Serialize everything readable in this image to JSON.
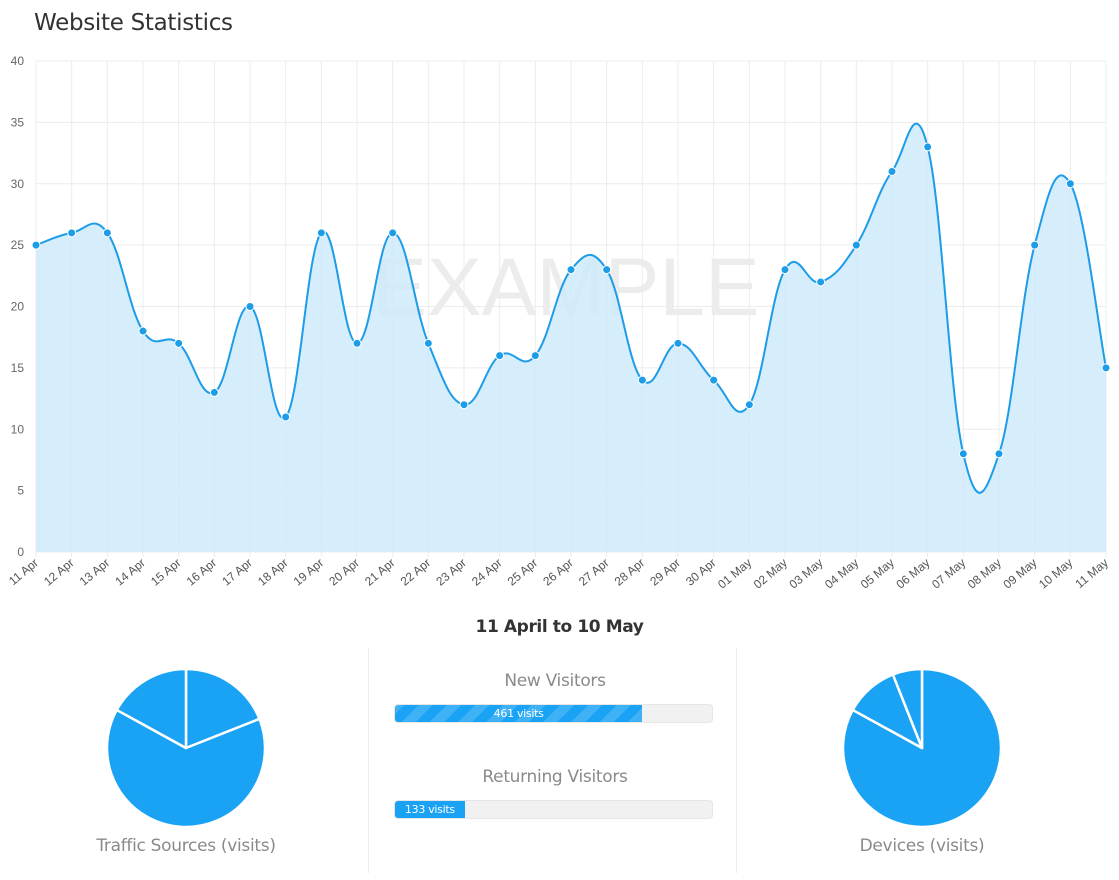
{
  "page": {
    "title": "Website Statistics",
    "date_range": "11 April to 10 May",
    "watermark": "EXAMPLE"
  },
  "colors": {
    "line": "#1d9ce8",
    "fill": "#cfeafc",
    "point": "#1d9ce8",
    "pie": "#1aa3f5",
    "bar": "#1aa3f5",
    "grid": "#ececec"
  },
  "chart_data": [
    {
      "type": "area",
      "title": "",
      "xlabel": "",
      "ylabel": "",
      "ylim": [
        0,
        40
      ],
      "yticks": [
        0,
        5,
        10,
        15,
        20,
        25,
        30,
        35,
        40
      ],
      "grid": true,
      "categories": [
        "11 Apr",
        "12 Apr",
        "13 Apr",
        "14 Apr",
        "15 Apr",
        "16 Apr",
        "17 Apr",
        "18 Apr",
        "19 Apr",
        "20 Apr",
        "21 Apr",
        "22 Apr",
        "23 Apr",
        "24 Apr",
        "25 Apr",
        "26 Apr",
        "27 Apr",
        "28 Apr",
        "29 Apr",
        "30 Apr",
        "01 May",
        "02 May",
        "03 May",
        "04 May",
        "05 May",
        "06 May",
        "07 May",
        "08 May",
        "09 May",
        "10 May",
        "11 May"
      ],
      "values": [
        25,
        26,
        26,
        18,
        17,
        13,
        20,
        11,
        26,
        17,
        26,
        17,
        12,
        16,
        16,
        23,
        23,
        14,
        17,
        14,
        12,
        23,
        22,
        25,
        31,
        33,
        8,
        8,
        25,
        30,
        15
      ]
    },
    {
      "type": "pie",
      "title": "Traffic Sources (visits)",
      "values": [
        19,
        64,
        17
      ]
    },
    {
      "type": "pie",
      "title": "Devices (visits)",
      "values": [
        83,
        11,
        6
      ]
    }
  ],
  "stats": {
    "new_visitors": {
      "title": "New Visitors",
      "label": "461 visits",
      "fraction": 0.78
    },
    "returning_visitors": {
      "title": "Returning Visitors",
      "label": "133 visits",
      "fraction": 0.22
    }
  }
}
